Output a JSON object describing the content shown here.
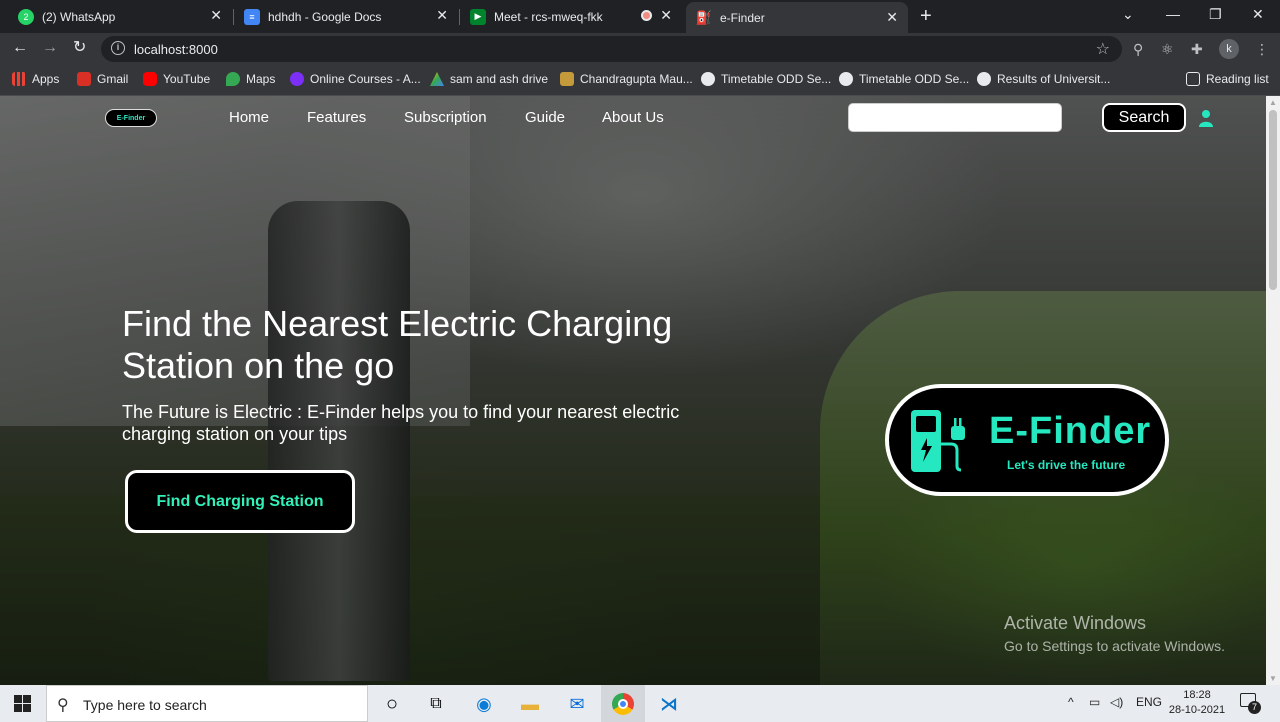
{
  "browser": {
    "tabs": [
      {
        "title": "(2) WhatsApp",
        "badge": "2",
        "color": "#25d366",
        "active": false
      },
      {
        "title": "hdhdh - Google Docs",
        "color": "#4285f4",
        "active": false
      },
      {
        "title": "Meet - rcs-mweq-fkk",
        "color": "#00832d",
        "active": false
      },
      {
        "title": "e-Finder",
        "color": "#26e8c0",
        "active": true
      }
    ],
    "url": "localhost:8000",
    "profile_initial": "k",
    "bookmarks": [
      {
        "label": "Apps",
        "color": "#ea4335"
      },
      {
        "label": "Gmail",
        "color": "#d93025"
      },
      {
        "label": "YouTube",
        "color": "#ff0000"
      },
      {
        "label": "Maps",
        "color": "#34a853"
      },
      {
        "label": "Online Courses - A...",
        "color": "#7b2ff7"
      },
      {
        "label": "sam and ash drive",
        "color": "#fbbc04"
      },
      {
        "label": "Chandragupta Mau...",
        "color": "#c49a3a"
      },
      {
        "label": "Timetable ODD Se...",
        "color": "#e8eaed"
      },
      {
        "label": "Timetable ODD Se...",
        "color": "#e8eaed"
      },
      {
        "label": "Results of Universit...",
        "color": "#e8eaed"
      }
    ],
    "reading_list": "Reading list"
  },
  "site": {
    "logo_text": "E-Finder",
    "nav": [
      "Home",
      "Features",
      "Subscription",
      "Guide",
      "About Us"
    ],
    "search": {
      "value": "",
      "button_label": "Search"
    },
    "hero": {
      "title": "Find the Nearest Electric Charging Station on the go",
      "subtitle": "The Future is Electric : E-Finder helps you to find your nearest electric charging station on your tips",
      "cta_label": "Find Charging Station"
    },
    "brand_card": {
      "name": "E-Finder",
      "tagline": "Let's drive the future"
    },
    "accent_color": "#26e8c0"
  },
  "watermark": {
    "line1": "Activate Windows",
    "line2": "Go to Settings to activate Windows."
  },
  "taskbar": {
    "search_placeholder": "Type here to search",
    "language": "ENG",
    "time": "18:28",
    "date": "28-10-2021",
    "notification_count": "7"
  }
}
